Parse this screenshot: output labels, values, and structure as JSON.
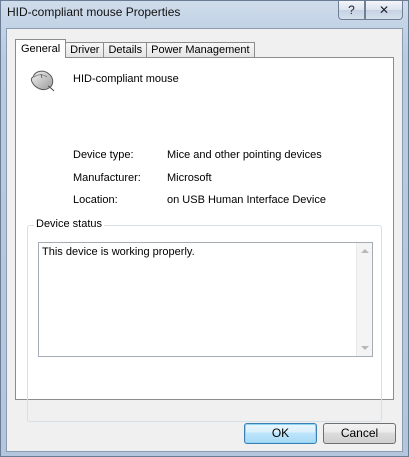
{
  "window": {
    "title": "HID-compliant mouse Properties",
    "help_glyph": "?",
    "close_glyph": "✕"
  },
  "tabs": [
    {
      "label": "General",
      "active": true
    },
    {
      "label": "Driver",
      "active": false
    },
    {
      "label": "Details",
      "active": false
    },
    {
      "label": "Power Management",
      "active": false
    }
  ],
  "device": {
    "icon": "mouse-icon",
    "name": "HID-compliant mouse"
  },
  "properties": [
    {
      "label": "Device type:",
      "value": "Mice and other pointing devices"
    },
    {
      "label": "Manufacturer:",
      "value": "Microsoft"
    },
    {
      "label": "Location:",
      "value": "on USB Human Interface Device"
    }
  ],
  "status": {
    "group_title": "Device status",
    "text": "This device is working properly."
  },
  "buttons": {
    "ok": "OK",
    "cancel": "Cancel"
  },
  "colors": {
    "accent": "#3c7fb1",
    "frame": "#b9cbe0"
  }
}
